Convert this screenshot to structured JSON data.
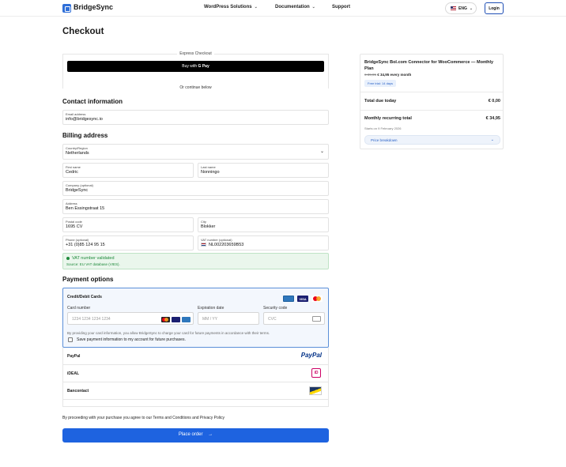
{
  "nav": {
    "brand": "BridgeSync",
    "links": [
      {
        "label": "WordPress Solutions",
        "chevron": "⌄"
      },
      {
        "label": "Documentation",
        "chevron": "⌄"
      },
      {
        "label": "Support",
        "chevron": ""
      }
    ],
    "language": "ENG",
    "login": "Login"
  },
  "page_title": "Checkout",
  "express": {
    "label": "Express Checkout",
    "gpay_prefix": "Buy with",
    "gpay_brand": "G Pay",
    "or_continue": "Or continue below"
  },
  "contact": {
    "heading": "Contact information",
    "email_label": "Email address",
    "email_value": "info@bridgesync.io"
  },
  "billing": {
    "heading": "Billing address",
    "country_label": "Country/Region",
    "country_value": "Netherlands",
    "first_name_label": "First name",
    "first_name_value": "Cedric",
    "last_name_label": "Last name",
    "last_name_value": "Nonningo",
    "company_label": "Company (optional)",
    "company_value": "BridgeSync",
    "address_label": "Address",
    "address_value": "Ben Essingstraat 15",
    "postal_label": "Postal code",
    "postal_value": "1695 CV",
    "city_label": "City",
    "city_value": "Blokker",
    "phone_label": "Phone (optional)",
    "phone_value": "+31 (0)85 124 95 15",
    "vat_label": "VAT number (optional)",
    "vat_value": "NL002203659B53",
    "vat_status": "VAT number validated",
    "vat_source": "Source: EU VAT database (VIES)."
  },
  "payment": {
    "heading": "Payment options",
    "card_title": "Credit/Debit Cards",
    "card_number_label": "Card number",
    "card_number_placeholder": "1234 1234 1234 1234",
    "expiry_label": "Expiration date",
    "expiry_placeholder": "MM / YY",
    "cvc_label": "Security code",
    "cvc_placeholder": "CVC",
    "consent_text": "By providing your card information, you allow BridgeSync to charge your card for future payments in accordance with their terms.",
    "save_label": "Save payment information to my account for future purchases.",
    "methods": [
      "PayPal",
      "iDEAL",
      "Bancontact"
    ],
    "paypal_logo": "PayPal",
    "ideal_logo": "iD",
    "visa_text": "VISA"
  },
  "terms_text": "By proceeding with your purchase you agree to our Terms and Conditions and Privacy Policy",
  "place_order": "Place order",
  "place_order_arrow": "→",
  "summary": {
    "product": "BridgeSync Bol.com Connector for WooCommerce — Monthly Plan",
    "old_price": "€ 39,95",
    "new_price": "€ 34,95 every month",
    "trial": "Free trial: 14 days",
    "total_today_label": "Total due today",
    "total_today_value": "€ 0,00",
    "recurring_label": "Monthly recurring total",
    "recurring_value": "€ 34,95",
    "starts_on": "Starts on 9 February 2026",
    "breakdown_label": "Price breakdown"
  }
}
